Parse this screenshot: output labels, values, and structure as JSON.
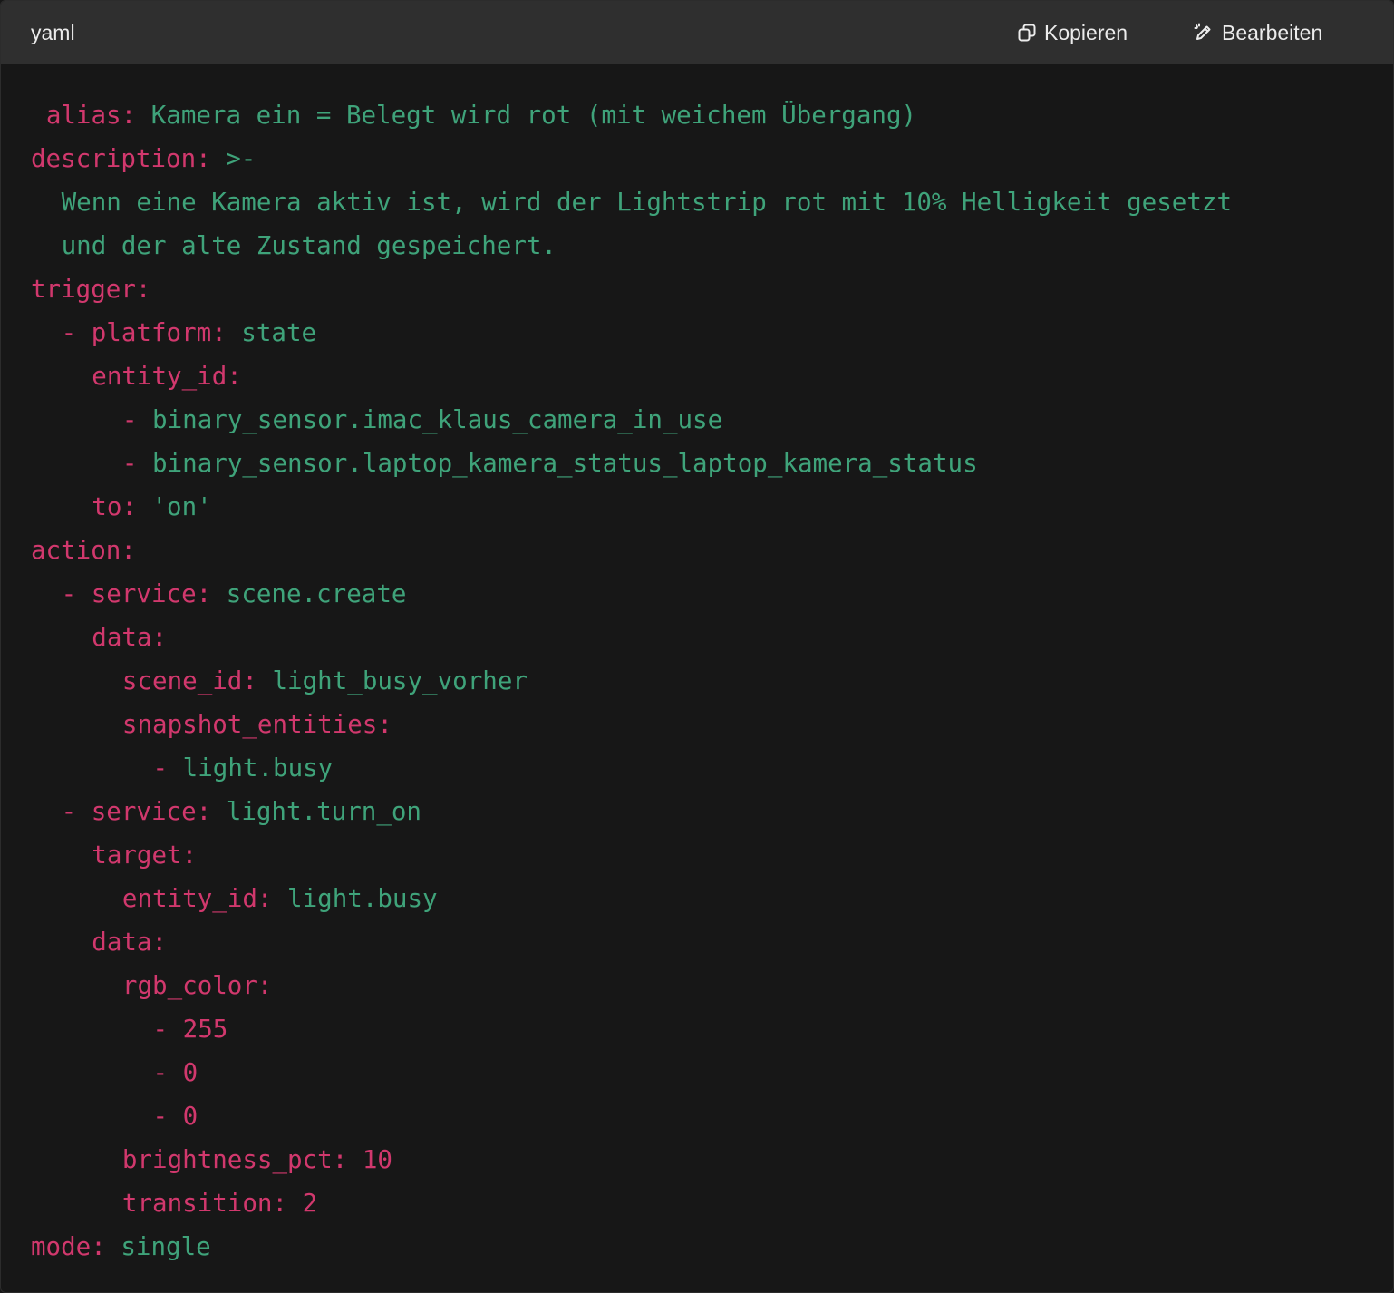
{
  "header": {
    "language": "yaml",
    "copy_label": "Kopieren",
    "edit_label": "Bearbeiten"
  },
  "colors": {
    "header_bg": "#2f2f2f",
    "code_bg": "#171717",
    "key": "#d1386d",
    "value": "#3fa37a",
    "header_text": "#ececec"
  },
  "code": {
    "lines": [
      {
        "indent": 1,
        "parts": [
          {
            "t": "alias:",
            "c": "k"
          },
          {
            "t": " Kamera ein = Belegt wird rot (mit weichem Übergang)",
            "c": "v"
          }
        ]
      },
      {
        "indent": 0,
        "parts": [
          {
            "t": "description:",
            "c": "k"
          },
          {
            "t": " >-",
            "c": "v"
          }
        ]
      },
      {
        "indent": 2,
        "parts": [
          {
            "t": "Wenn eine Kamera aktiv ist, wird der Lightstrip rot mit 10% Helligkeit gesetzt",
            "c": "v"
          }
        ]
      },
      {
        "indent": 2,
        "parts": [
          {
            "t": "und der alte Zustand gespeichert.",
            "c": "v"
          }
        ]
      },
      {
        "indent": 0,
        "parts": [
          {
            "t": "trigger:",
            "c": "k"
          }
        ]
      },
      {
        "indent": 2,
        "parts": [
          {
            "t": "- platform:",
            "c": "k"
          },
          {
            "t": " state",
            "c": "v"
          }
        ]
      },
      {
        "indent": 4,
        "parts": [
          {
            "t": "entity_id:",
            "c": "k"
          }
        ]
      },
      {
        "indent": 6,
        "parts": [
          {
            "t": "- ",
            "c": "k"
          },
          {
            "t": "binary_sensor.imac_klaus_camera_in_use",
            "c": "v"
          }
        ]
      },
      {
        "indent": 6,
        "parts": [
          {
            "t": "- ",
            "c": "k"
          },
          {
            "t": "binary_sensor.laptop_kamera_status_laptop_kamera_status",
            "c": "v"
          }
        ]
      },
      {
        "indent": 4,
        "parts": [
          {
            "t": "to:",
            "c": "k"
          },
          {
            "t": " 'on'",
            "c": "v"
          }
        ]
      },
      {
        "indent": 0,
        "parts": [
          {
            "t": "action:",
            "c": "k"
          }
        ]
      },
      {
        "indent": 2,
        "parts": [
          {
            "t": "- service:",
            "c": "k"
          },
          {
            "t": " scene.create",
            "c": "v"
          }
        ]
      },
      {
        "indent": 4,
        "parts": [
          {
            "t": "data:",
            "c": "k"
          }
        ]
      },
      {
        "indent": 6,
        "parts": [
          {
            "t": "scene_id:",
            "c": "k"
          },
          {
            "t": " light_busy_vorher",
            "c": "v"
          }
        ]
      },
      {
        "indent": 6,
        "parts": [
          {
            "t": "snapshot_entities:",
            "c": "k"
          }
        ]
      },
      {
        "indent": 8,
        "parts": [
          {
            "t": "- ",
            "c": "k"
          },
          {
            "t": "light.busy",
            "c": "v"
          }
        ]
      },
      {
        "indent": 2,
        "parts": [
          {
            "t": "- service:",
            "c": "k"
          },
          {
            "t": " light.turn_on",
            "c": "v"
          }
        ]
      },
      {
        "indent": 4,
        "parts": [
          {
            "t": "target:",
            "c": "k"
          }
        ]
      },
      {
        "indent": 6,
        "parts": [
          {
            "t": "entity_id:",
            "c": "k"
          },
          {
            "t": " light.busy",
            "c": "v"
          }
        ]
      },
      {
        "indent": 4,
        "parts": [
          {
            "t": "data:",
            "c": "k"
          }
        ]
      },
      {
        "indent": 6,
        "parts": [
          {
            "t": "rgb_color:",
            "c": "k"
          }
        ]
      },
      {
        "indent": 8,
        "parts": [
          {
            "t": "- ",
            "c": "k"
          },
          {
            "t": "255",
            "c": "n"
          }
        ]
      },
      {
        "indent": 8,
        "parts": [
          {
            "t": "- ",
            "c": "k"
          },
          {
            "t": "0",
            "c": "n"
          }
        ]
      },
      {
        "indent": 8,
        "parts": [
          {
            "t": "- ",
            "c": "k"
          },
          {
            "t": "0",
            "c": "n"
          }
        ]
      },
      {
        "indent": 6,
        "parts": [
          {
            "t": "brightness_pct:",
            "c": "k"
          },
          {
            "t": " 10",
            "c": "n"
          }
        ]
      },
      {
        "indent": 6,
        "parts": [
          {
            "t": "transition:",
            "c": "k"
          },
          {
            "t": " 2",
            "c": "n"
          }
        ]
      },
      {
        "indent": 0,
        "parts": [
          {
            "t": "mode:",
            "c": "k"
          },
          {
            "t": " single",
            "c": "v"
          }
        ]
      }
    ]
  }
}
